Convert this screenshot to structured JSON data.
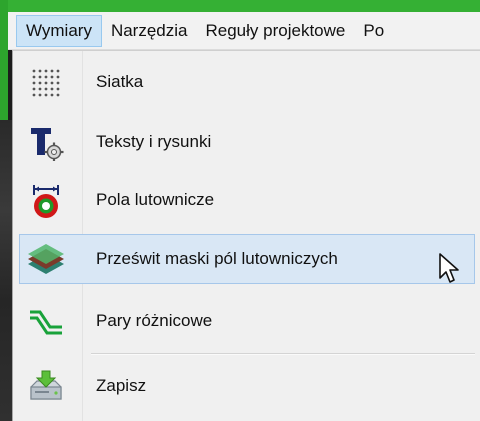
{
  "menubar": {
    "items": [
      {
        "label": "Wymiary",
        "active": true
      },
      {
        "label": "Narzędzia",
        "active": false
      },
      {
        "label": "Reguły projektowe",
        "active": false
      },
      {
        "label": "Po",
        "active": false
      }
    ]
  },
  "dropdown": {
    "items": [
      {
        "label": "Siatka",
        "icon": "grid-dots-icon"
      },
      {
        "label": "Teksty i rysunki",
        "icon": "text-gear-icon"
      },
      {
        "label": "Pola lutownicze",
        "icon": "solder-pad-icon"
      },
      {
        "label": "Prześwit maski pól lutowniczych",
        "icon": "solder-mask-layers-icon",
        "hovered": true
      },
      {
        "label": "Pary różnicowe",
        "icon": "differential-pair-icon"
      },
      {
        "label": "Zapisz",
        "icon": "save-drive-icon"
      }
    ]
  },
  "colors": {
    "accent_green": "#35b034",
    "hover_bg": "#d9e7f5",
    "active_menu_bg": "#cce4f7"
  }
}
